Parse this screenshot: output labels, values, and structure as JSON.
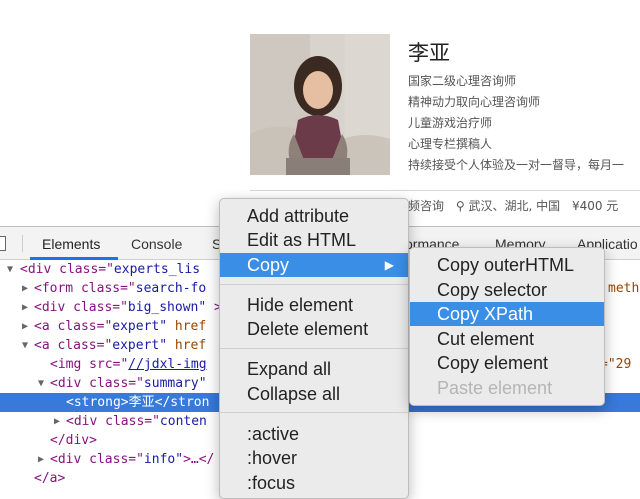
{
  "page": {
    "name": "李亚",
    "bio_lines": [
      "国家二级心理咨询师",
      "精神动力取向心理咨询师",
      "儿童游戏治疗师",
      "心理专栏撰稿人",
      "持续接受个人体验及一对一督导，每月一"
    ],
    "meta": {
      "service": "频咨询",
      "location": "武汉、湖北, 中国",
      "price": "¥400 元"
    }
  },
  "devtools": {
    "tabs": [
      "Elements",
      "Console",
      "S",
      "ormance",
      "Memory",
      "Applicatio"
    ],
    "dom": [
      {
        "a": "<div class=\"",
        "b": "experts_lis"
      },
      {
        "a": "<form class=\"",
        "b": "search-fo",
        "right": "meth"
      },
      {
        "a": "<div class=\"",
        "b": "big_shown\"",
        "c": " ></"
      },
      {
        "a": "<a class=\"",
        "b": "expert\"",
        "c": " href"
      },
      {
        "a": "<a class=\"",
        "b": "expert\"",
        "c": " href"
      },
      {
        "a": "<img src=\"",
        "b": "//jdxl-img",
        "right": "=\"29"
      },
      {
        "a": "<div class=\"",
        "b": "summary\""
      },
      {
        "a": "<strong>",
        "b": "李亚",
        "c": "</stron"
      },
      {
        "a": "<div class=\"",
        "b": "conten"
      },
      {
        "a": "</div>"
      },
      {
        "a": "<div class=\"",
        "b": "info\"",
        "c": ">…</"
      },
      {
        "a": "</a>"
      }
    ]
  },
  "context_menu": {
    "items": [
      "Add attribute",
      "Edit as HTML",
      "Copy",
      "Hide element",
      "Delete element",
      "Expand all",
      "Collapse all",
      ":active",
      ":hover",
      ":focus"
    ],
    "copy_arrow": "▶"
  },
  "copy_submenu": {
    "items": [
      "Copy outerHTML",
      "Copy selector",
      "Copy XPath",
      "Cut element",
      "Copy element",
      "Paste element"
    ]
  },
  "colors": {
    "selection_blue": "#3879d9",
    "menu_highlight": "#3a8ee6",
    "tag_purple": "#881280",
    "attr_brown": "#994500",
    "value_blue": "#1a1aa6"
  }
}
